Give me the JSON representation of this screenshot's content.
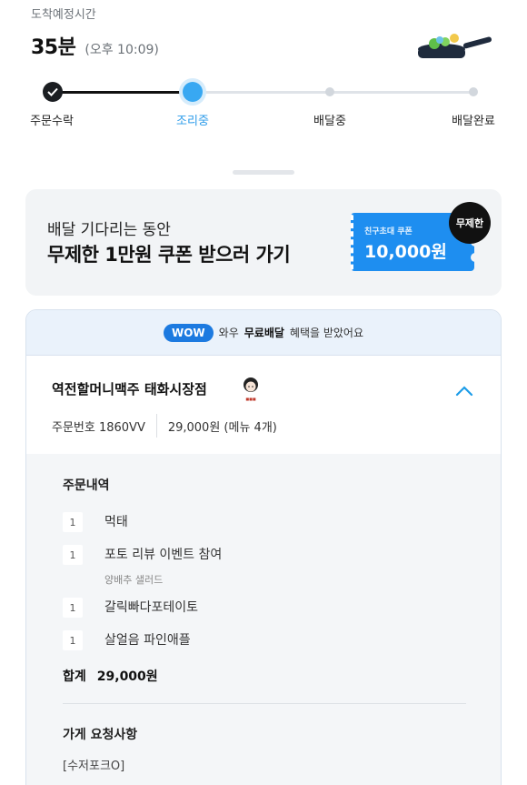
{
  "eta": {
    "label": "도착예정시간",
    "minutes": "35분",
    "time": "(오후 10:09)"
  },
  "progress": {
    "steps": [
      {
        "label": "주문수락",
        "state": "done"
      },
      {
        "label": "조리중",
        "state": "active"
      },
      {
        "label": "배달중",
        "state": "todo"
      },
      {
        "label": "배달완료",
        "state": "todo"
      }
    ]
  },
  "banner": {
    "subtitle": "배달 기다리는 동안",
    "title": "무제한 1만원 쿠폰 받으러 가기",
    "coupon_label": "친구초대 쿠폰",
    "coupon_amount": "10,000원",
    "badge": "무제한"
  },
  "wow": {
    "badge": "WOW",
    "text_prefix": "와우",
    "text_bold": "무료배달",
    "text_suffix": "혜택을 받았어요"
  },
  "store": {
    "name": "역전할머니맥주 태화시장점",
    "order_number": "주문번호 1860VV",
    "price_summary": "29,000원 (메뉴 4개)"
  },
  "order_details": {
    "title": "주문내역",
    "items": [
      {
        "qty": "1",
        "name": "먹태",
        "option": ""
      },
      {
        "qty": "1",
        "name": "포토 리뷰 이벤트 참여",
        "option": "양배추 샐러드"
      },
      {
        "qty": "1",
        "name": "갈릭빠다포테이토",
        "option": ""
      },
      {
        "qty": "1",
        "name": "살얼음 파인애플",
        "option": ""
      }
    ],
    "total_label": "합계",
    "total_value": "29,000원"
  },
  "request": {
    "title": "가게 요청사항",
    "value": "[수저포크O]"
  },
  "colors": {
    "accent_blue": "#38a8f2",
    "coupon_blue": "#1e8ef0",
    "wow_blue": "#1c7ae0"
  }
}
